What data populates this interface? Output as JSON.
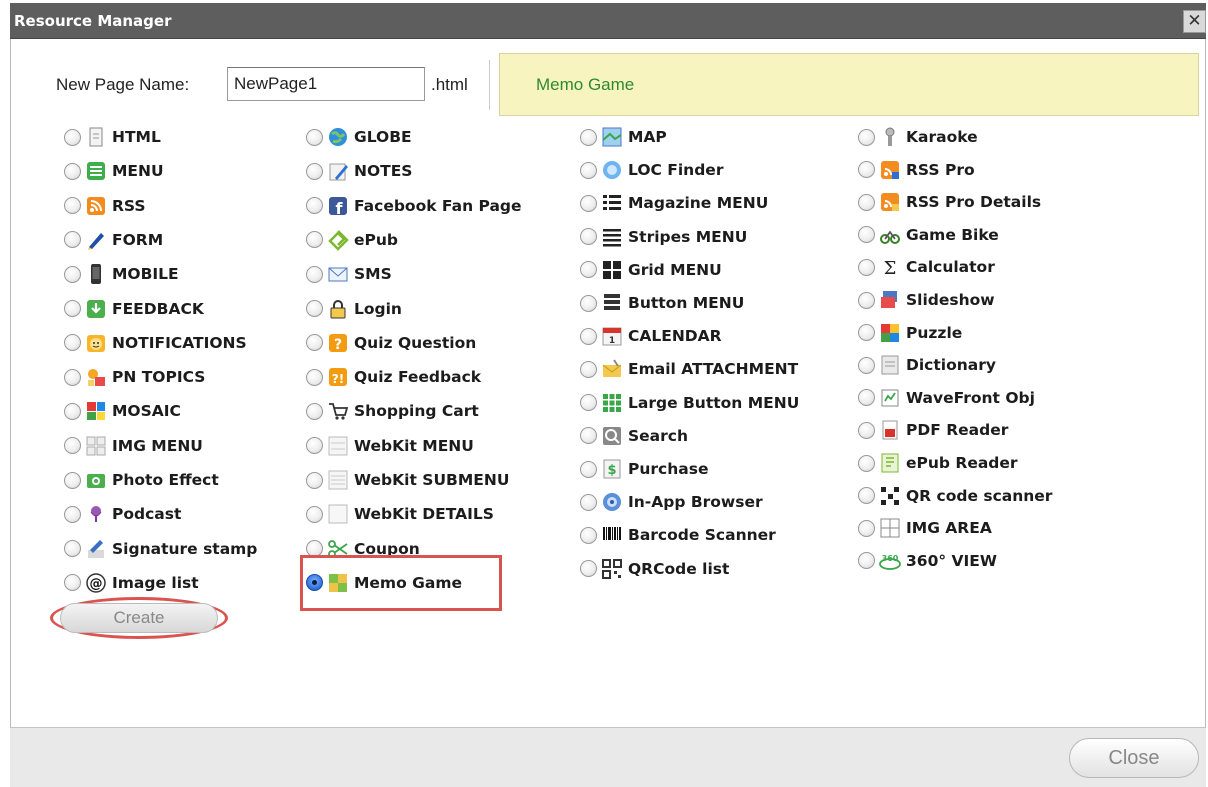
{
  "window": {
    "title": "Resource Manager",
    "close_glyph": "✕"
  },
  "new_page": {
    "label": "New Page Name:",
    "value": "NewPage1",
    "extension": ".html"
  },
  "preview": {
    "text": "Memo Game"
  },
  "selected": "Memo Game",
  "columns": [
    [
      {
        "label": "HTML",
        "icon": "document-icon"
      },
      {
        "label": "MENU",
        "icon": "menu-list-icon"
      },
      {
        "label": "RSS",
        "icon": "rss-icon"
      },
      {
        "label": "FORM",
        "icon": "pencil-icon"
      },
      {
        "label": "MOBILE",
        "icon": "phone-icon"
      },
      {
        "label": "FEEDBACK",
        "icon": "download-arrow-icon"
      },
      {
        "label": "NOTIFICATIONS",
        "icon": "smiley-icon"
      },
      {
        "label": "PN TOPICS",
        "icon": "topics-icon"
      },
      {
        "label": "MOSAIC",
        "icon": "mosaic-icon"
      },
      {
        "label": "IMG MENU",
        "icon": "image-grid-icon"
      },
      {
        "label": "Photo Effect",
        "icon": "camera-icon"
      },
      {
        "label": "Podcast",
        "icon": "microphone-icon"
      },
      {
        "label": "Signature stamp",
        "icon": "signature-icon"
      },
      {
        "label": "Image list",
        "icon": "at-sign-icon"
      }
    ],
    [
      {
        "label": "GLOBE",
        "icon": "globe-icon"
      },
      {
        "label": "NOTES",
        "icon": "notes-icon"
      },
      {
        "label": "Facebook Fan Page",
        "icon": "facebook-icon"
      },
      {
        "label": "ePub",
        "icon": "epub-icon"
      },
      {
        "label": "SMS",
        "icon": "envelope-icon"
      },
      {
        "label": "Login",
        "icon": "lock-icon"
      },
      {
        "label": "Quiz Question",
        "icon": "question-icon"
      },
      {
        "label": "Quiz Feedback",
        "icon": "quiz-feedback-icon"
      },
      {
        "label": "Shopping Cart",
        "icon": "cart-icon"
      },
      {
        "label": "WebKit MENU",
        "icon": "webkit-menu-icon"
      },
      {
        "label": "WebKit SUBMENU",
        "icon": "webkit-submenu-icon"
      },
      {
        "label": "WebKit DETAILS",
        "icon": "webkit-details-icon"
      },
      {
        "label": "Coupon",
        "icon": "scissors-icon"
      },
      {
        "label": "Memo Game",
        "icon": "memo-game-icon"
      }
    ],
    [
      {
        "label": "MAP",
        "icon": "map-icon"
      },
      {
        "label": "LOC Finder",
        "icon": "location-icon"
      },
      {
        "label": "Magazine MENU",
        "icon": "list-icon"
      },
      {
        "label": "Stripes MENU",
        "icon": "stripes-icon"
      },
      {
        "label": "Grid MENU",
        "icon": "grid-icon"
      },
      {
        "label": "Button MENU",
        "icon": "button-menu-icon"
      },
      {
        "label": "CALENDAR",
        "icon": "calendar-icon"
      },
      {
        "label": "Email ATTACHMENT",
        "icon": "email-attachment-icon"
      },
      {
        "label": "Large Button MENU",
        "icon": "large-grid-icon"
      },
      {
        "label": "Search",
        "icon": "search-icon"
      },
      {
        "label": "Purchase",
        "icon": "dollar-icon"
      },
      {
        "label": "In-App Browser",
        "icon": "browser-icon"
      },
      {
        "label": "Barcode Scanner",
        "icon": "barcode-icon"
      },
      {
        "label": "QRCode list",
        "icon": "qrcode-icon"
      }
    ],
    [
      {
        "label": "Karaoke",
        "icon": "karaoke-mic-icon"
      },
      {
        "label": "RSS Pro",
        "icon": "rss-pro-icon"
      },
      {
        "label": "RSS Pro Details",
        "icon": "rss-details-icon"
      },
      {
        "label": "Game Bike",
        "icon": "bike-icon"
      },
      {
        "label": "Calculator",
        "icon": "sigma-icon"
      },
      {
        "label": "Slideshow",
        "icon": "slideshow-icon"
      },
      {
        "label": "Puzzle",
        "icon": "puzzle-icon"
      },
      {
        "label": "Dictionary",
        "icon": "dictionary-icon"
      },
      {
        "label": "WaveFront Obj",
        "icon": "wavefront-icon"
      },
      {
        "label": "PDF Reader",
        "icon": "pdf-icon"
      },
      {
        "label": "ePub Reader",
        "icon": "epub-reader-icon"
      },
      {
        "label": "QR code scanner",
        "icon": "qr-scanner-icon"
      },
      {
        "label": "IMG AREA",
        "icon": "img-area-icon"
      },
      {
        "label": "360° VIEW",
        "icon": "view-360-icon"
      }
    ]
  ],
  "buttons": {
    "create": "Create",
    "close": "Close"
  },
  "colors": {
    "titlebar": "#5e5e5e",
    "preview_bg": "#f7f4c0",
    "preview_text": "#2f8a2f",
    "highlight": "#d9534f",
    "radio_checked": "#2d6fd6"
  }
}
